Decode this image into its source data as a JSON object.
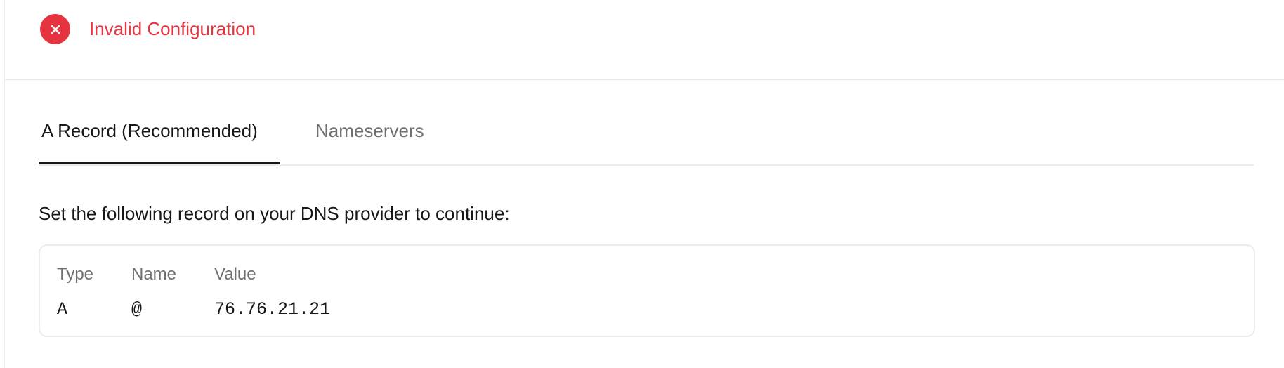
{
  "status": {
    "text": "Invalid Configuration",
    "icon": "close-icon",
    "color": "#e5343f"
  },
  "tabs": [
    {
      "label": "A Record (Recommended)",
      "active": true
    },
    {
      "label": "Nameservers",
      "active": false
    }
  ],
  "instruction": "Set the following record on your DNS provider to continue:",
  "record": {
    "headers": {
      "type": "Type",
      "name": "Name",
      "value": "Value"
    },
    "row": {
      "type": "A",
      "name": "@",
      "value": "76.76.21.21"
    }
  }
}
